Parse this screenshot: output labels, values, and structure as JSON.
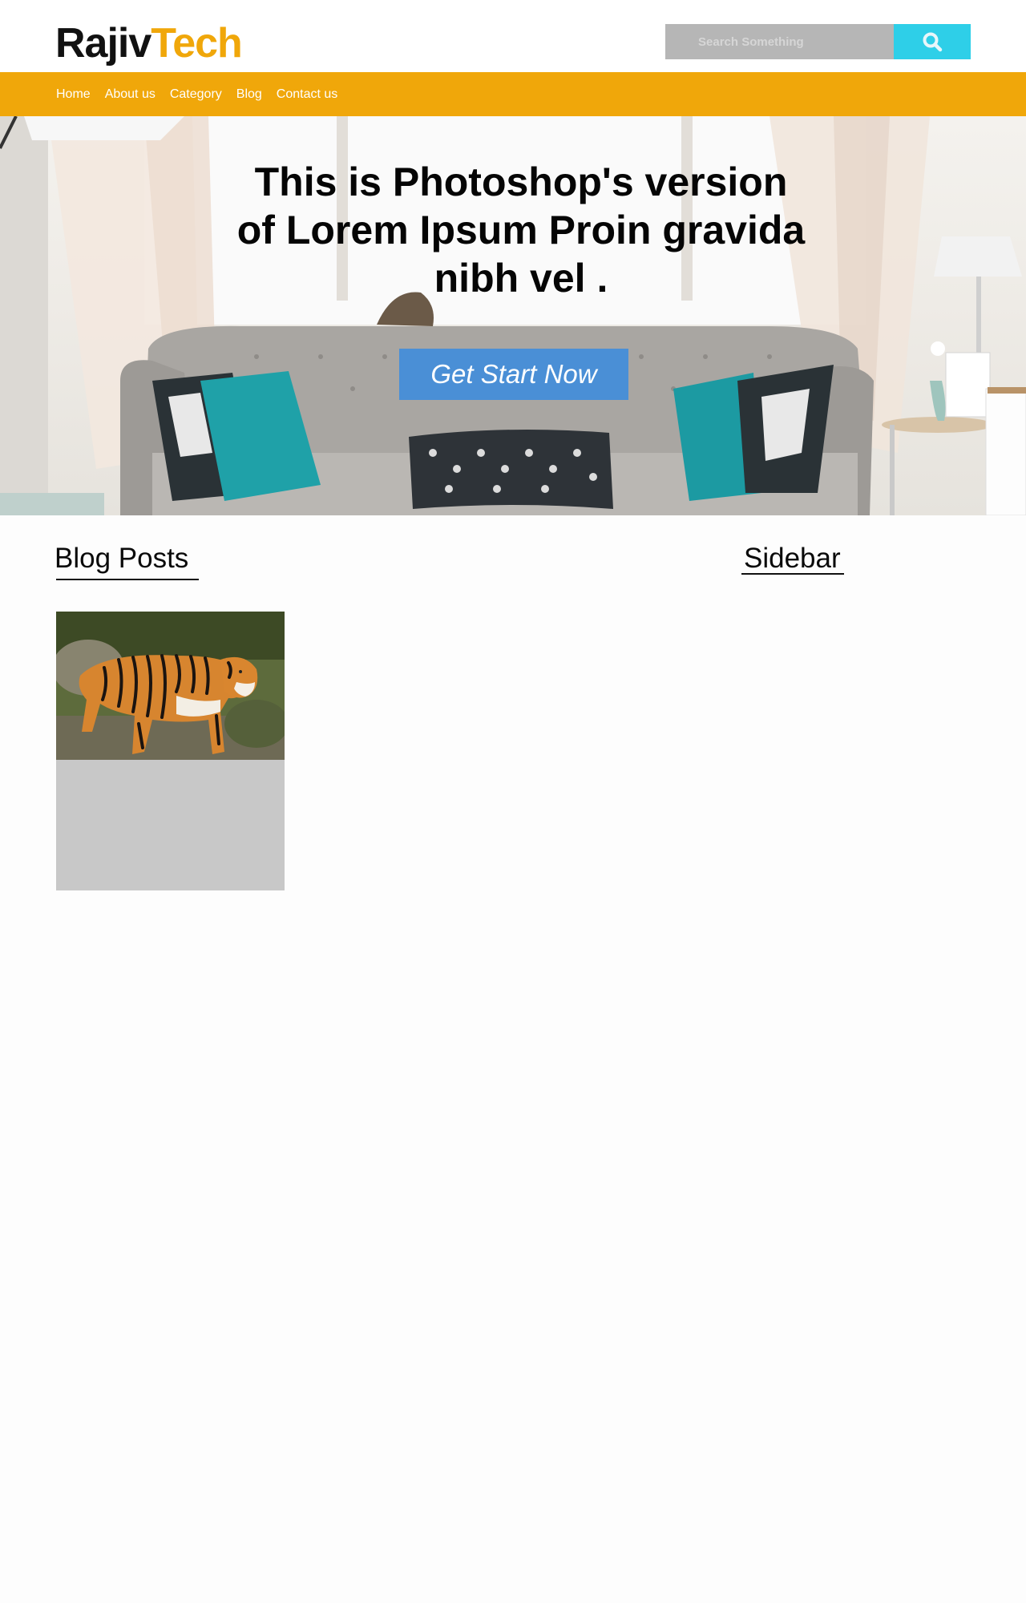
{
  "header": {
    "logo_part1": "Rajiv",
    "logo_part2": "Tech",
    "search_placeholder": "Search Something"
  },
  "nav": {
    "items": [
      "Home",
      "About us",
      "Category",
      "Blog",
      "Contact us"
    ]
  },
  "hero": {
    "title": "This is Photoshop's version of Lorem Ipsum Proin gravida nibh vel .",
    "button_label": "Get Start Now"
  },
  "main": {
    "blog_heading": "Blog Posts",
    "sidebar_heading": "Sidebar"
  },
  "colors": {
    "accent": "#f0a70a",
    "search_button": "#2ecfe8",
    "cta_button": "#4a8fd6",
    "card_bg": "#c8c8c8"
  },
  "icons": {
    "search": "search-icon"
  }
}
